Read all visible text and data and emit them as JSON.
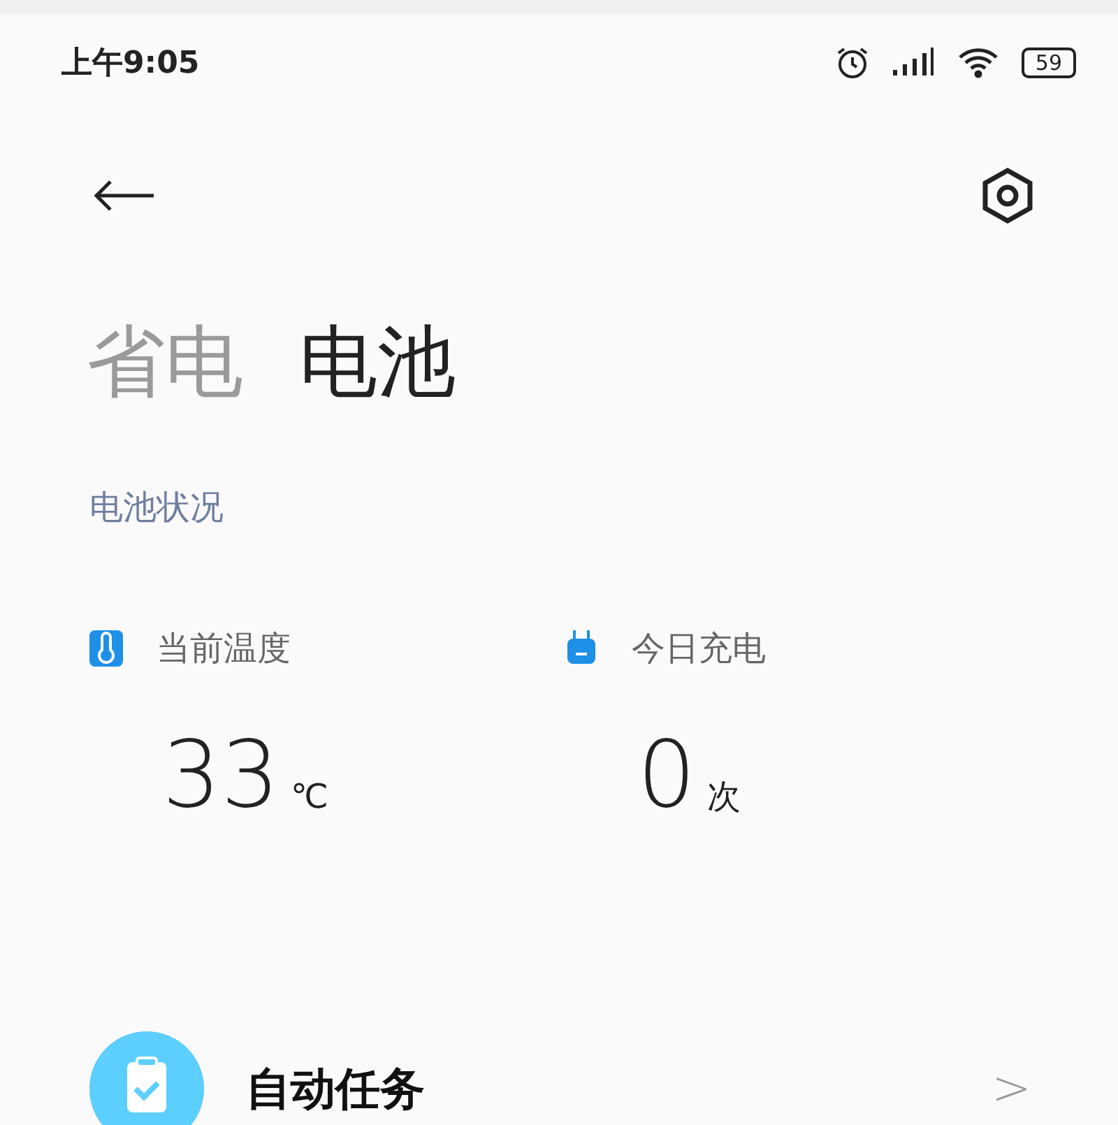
{
  "status_bar": {
    "time": "上午9:05",
    "battery": "59"
  },
  "tabs": [
    {
      "label": "省电",
      "selected": false
    },
    {
      "label": "电池",
      "selected": true
    }
  ],
  "section_title": "电池状况",
  "stats": [
    {
      "kind": "temperature",
      "label": "当前温度",
      "value": "33",
      "unit": "℃"
    },
    {
      "kind": "charge",
      "label": "今日充电",
      "value": "0",
      "unit": "次"
    }
  ],
  "list_items": [
    {
      "title": "自动任务",
      "chevron": ">"
    }
  ]
}
